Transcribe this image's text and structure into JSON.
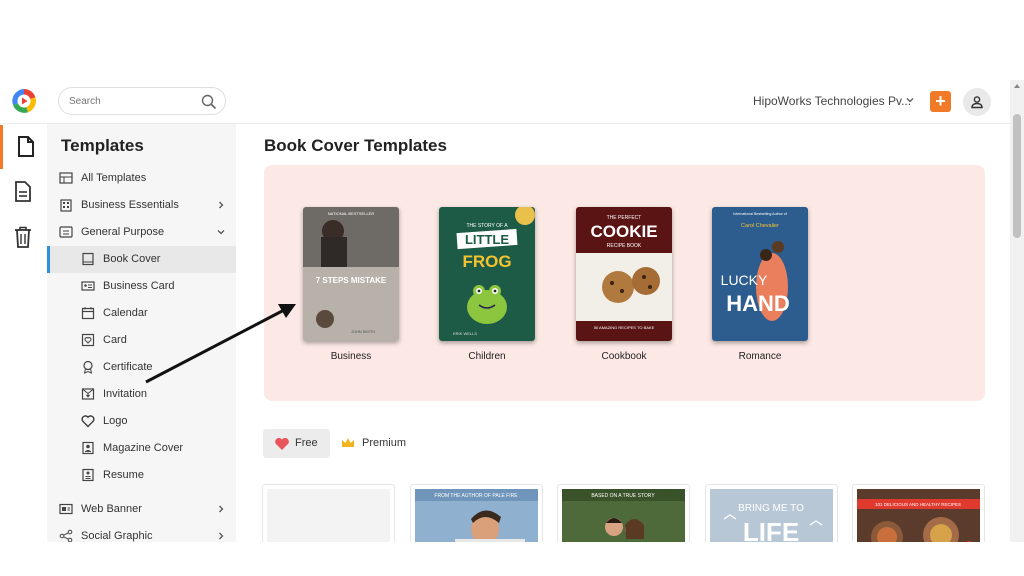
{
  "search": {
    "placeholder": "Search"
  },
  "header": {
    "org_name": "HipoWorks Technologies Pv...",
    "add_label": "+"
  },
  "sidebar": {
    "title": "Templates",
    "items": [
      {
        "label": "All Templates"
      },
      {
        "label": "Business Essentials"
      },
      {
        "label": "General Purpose"
      },
      {
        "label": "Book Cover"
      },
      {
        "label": "Business Card"
      },
      {
        "label": "Calendar"
      },
      {
        "label": "Card"
      },
      {
        "label": "Certificate"
      },
      {
        "label": "Invitation"
      },
      {
        "label": "Logo"
      },
      {
        "label": "Magazine Cover"
      },
      {
        "label": "Resume"
      },
      {
        "label": "Web Banner"
      },
      {
        "label": "Social Graphic"
      }
    ]
  },
  "main": {
    "title": "Book Cover Templates",
    "categories": [
      {
        "label": "Business"
      },
      {
        "label": "Children"
      },
      {
        "label": "Cookbook"
      },
      {
        "label": "Romance"
      }
    ],
    "filters": {
      "free": "Free",
      "premium": "Premium"
    }
  },
  "covers": {
    "business": {
      "top": "NATIONAL BESTSELLER",
      "big": "7 STEPS MISTAKE",
      "author": "JOHN SMITH"
    },
    "children": {
      "small": "THE STORY OF A",
      "line1": "LITTLE",
      "line2": "FROG",
      "author": "ERIK WELLS"
    },
    "cookbook": {
      "small": "THE PERFECT",
      "big": "COOKIE",
      "sub": "RECIPE BOOK",
      "foot": "50 AMAZING RECIPES TO BAKE"
    },
    "romance": {
      "top": "International Bestselling Author of",
      "author": "Carol Chevalier",
      "line1": "LUCKY",
      "line2": "HAND"
    }
  },
  "thumbs": {
    "t2": "FROM THE AUTHOR OF PALE FIRE",
    "t3": "BASED ON A TRUE STORY",
    "t4a": "BRING ME TO",
    "t4b": "LIFE",
    "t5": "101 DELICIOUS AND HEALTHY RECIPES"
  },
  "colors": {
    "accent": "#f07a28",
    "active_indicator": "#2f8fd8",
    "panel_bg": "#fce9e5",
    "children_cover": "#1e5b47",
    "cookbook_cover": "#5a1414",
    "romance_cover": "#2c5d8e"
  }
}
